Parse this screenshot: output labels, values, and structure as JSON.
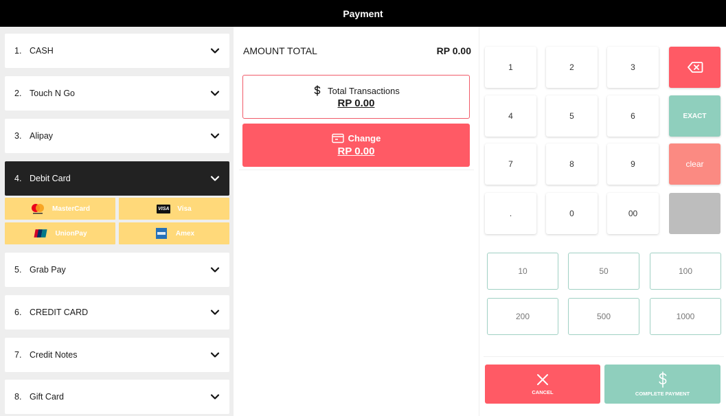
{
  "header": {
    "title": "Payment"
  },
  "methods": [
    {
      "num": "1.",
      "label": "CASH"
    },
    {
      "num": "2.",
      "label": "Touch N Go"
    },
    {
      "num": "3.",
      "label": "Alipay"
    },
    {
      "num": "4.",
      "label": "Debit Card"
    },
    {
      "num": "5.",
      "label": "Grab Pay"
    },
    {
      "num": "6.",
      "label": "CREDIT CARD"
    },
    {
      "num": "7.",
      "label": "Credit Notes"
    },
    {
      "num": "8.",
      "label": "Gift Card"
    }
  ],
  "debit_options": [
    "MasterCard",
    "Visa",
    "UnionPay",
    "Amex"
  ],
  "logos": {
    "visa": "VISA",
    "unionpay": "UnionPay"
  },
  "summary": {
    "amount_label": "AMOUNT TOTAL",
    "amount_value": "RP 0.00",
    "total_tx_label": "Total Transactions",
    "total_tx_value": "RP 0.00",
    "change_label": "Change",
    "change_value": "RP 0.00"
  },
  "keypad": {
    "keys": [
      "1",
      "2",
      "3",
      "4",
      "5",
      "6",
      "7",
      "8",
      "9",
      ".",
      "0",
      "00"
    ],
    "exact": "EXACT",
    "clear": "clear"
  },
  "quick_amounts": [
    "10",
    "50",
    "100",
    "200",
    "500",
    "1000"
  ],
  "actions": {
    "cancel": "CANCEL",
    "complete": "COMPLETE PAYMENT"
  },
  "colors": {
    "accent_red": "#ff5a65",
    "accent_green": "#8fcfbd",
    "active_dark": "#222222",
    "card_yellow": "#ffd97a"
  },
  "icons": [
    "chevron-down-icon",
    "dollar-icon",
    "wallet-icon",
    "backspace-icon",
    "close-icon",
    "mastercard-icon",
    "visa-icon",
    "unionpay-icon",
    "amex-icon"
  ]
}
